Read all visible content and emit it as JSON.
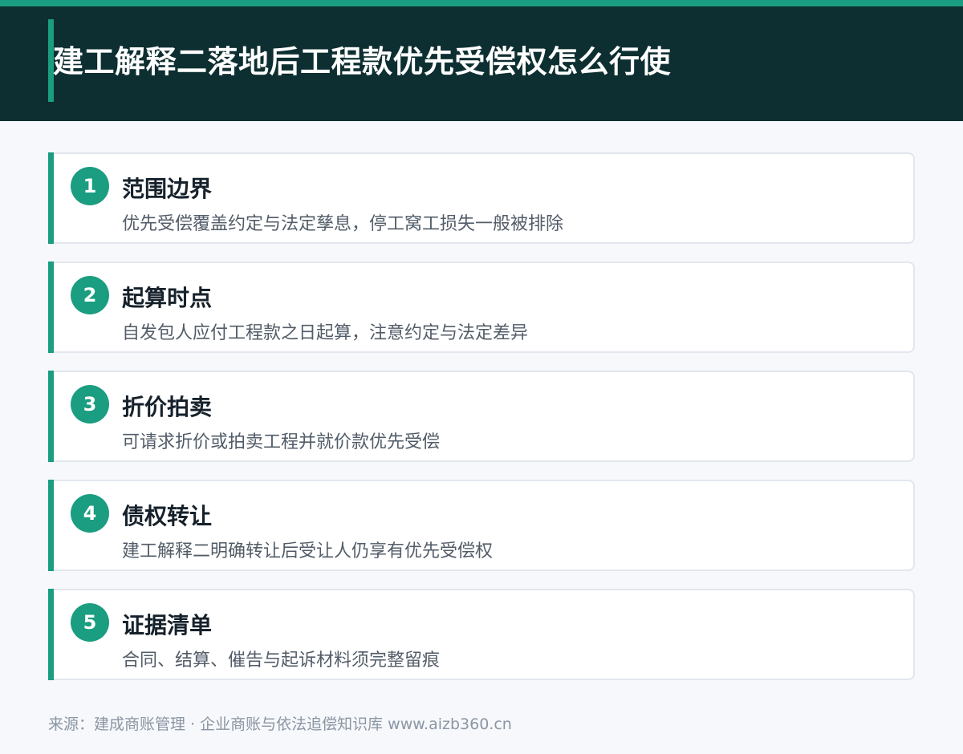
{
  "header": {
    "title": "建工解释二落地后工程款优先受偿权怎么行使"
  },
  "items": [
    {
      "number": "1",
      "title": "范围边界",
      "description": "优先受偿覆盖约定与法定孳息，停工窝工损失一般被排除"
    },
    {
      "number": "2",
      "title": "起算时点",
      "description": "自发包人应付工程款之日起算，注意约定与法定差异"
    },
    {
      "number": "3",
      "title": "折价拍卖",
      "description": "可请求折价或拍卖工程并就价款优先受偿"
    },
    {
      "number": "4",
      "title": "债权转让",
      "description": "建工解释二明确转让后受让人仍享有优先受偿权"
    },
    {
      "number": "5",
      "title": "证据清单",
      "description": "合同、结算、催告与起诉材料须完整留痕"
    }
  ],
  "footer": {
    "source": "来源：建成商账管理 · 企业商账与依法追偿知识库  www.aizb360.cn"
  },
  "colors": {
    "accent": "#1a9d80",
    "header_bg": "#0e2f31",
    "page_bg": "#f6f8fb"
  }
}
